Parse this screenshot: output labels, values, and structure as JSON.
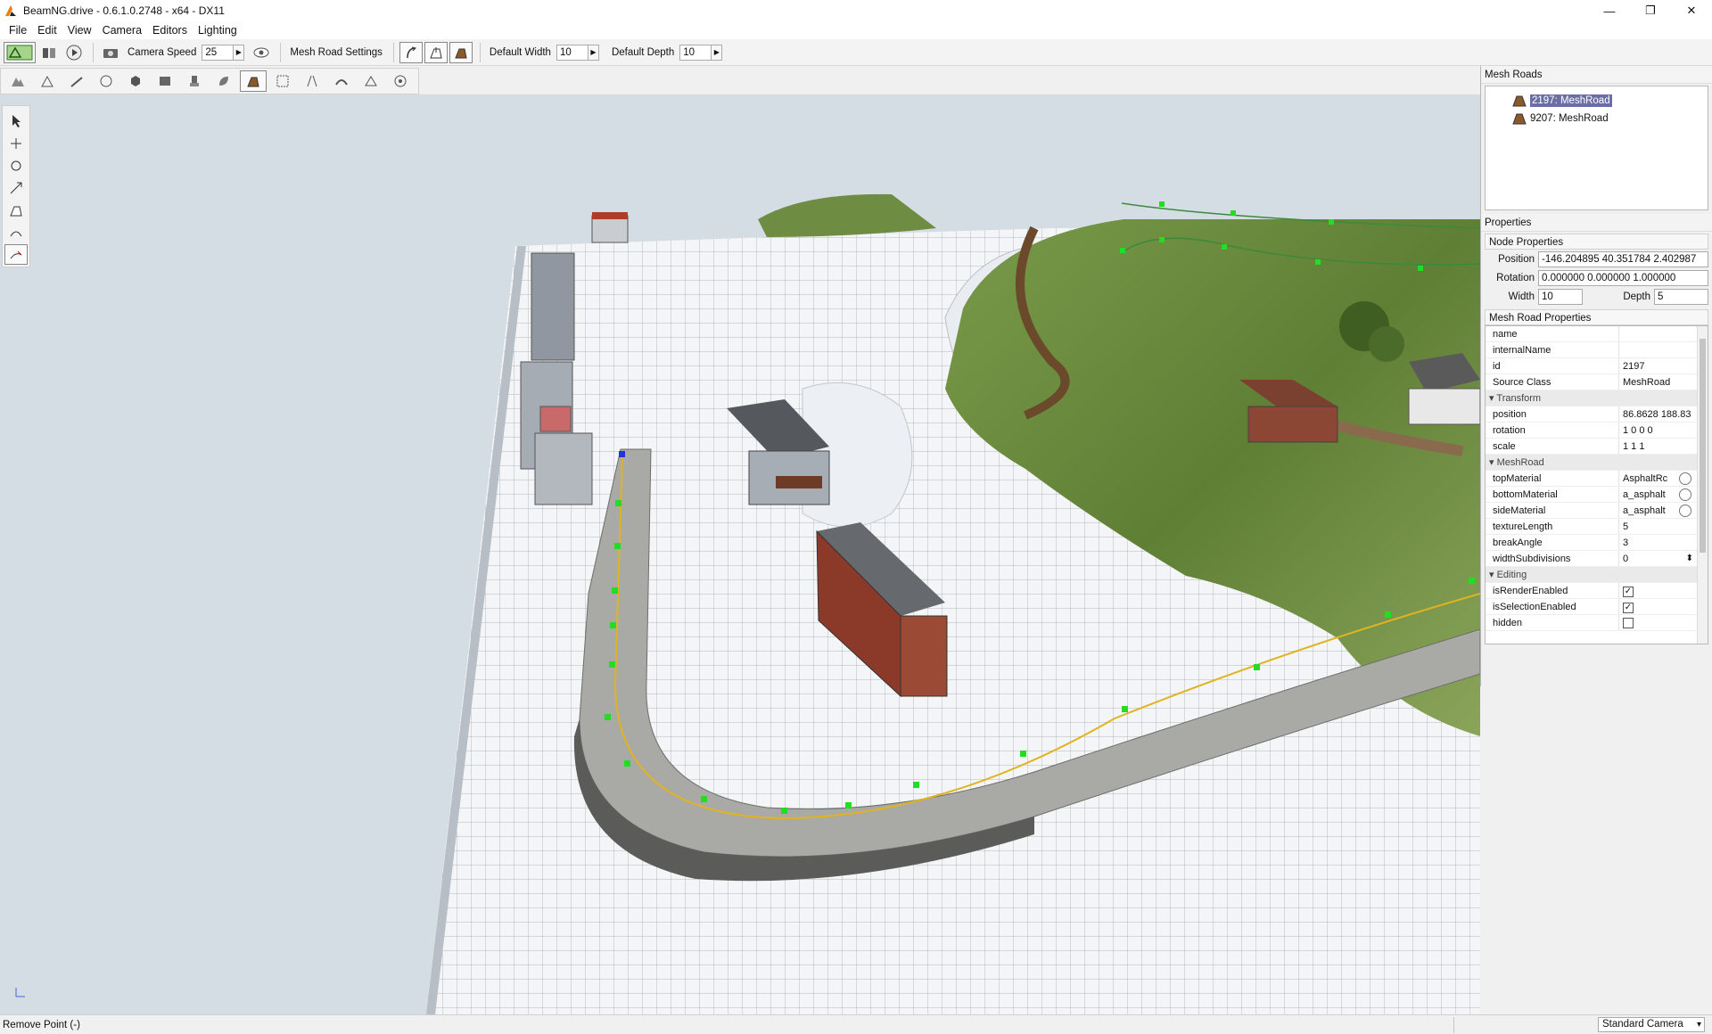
{
  "window": {
    "title": "BeamNG.drive - 0.6.1.0.2748 - x64 - DX11",
    "minimize": "—",
    "maximize": "❐",
    "close": "✕"
  },
  "menu": [
    "File",
    "Edit",
    "View",
    "Camera",
    "Editors",
    "Lighting"
  ],
  "toolbar": {
    "camera_speed_label": "Camera Speed",
    "camera_speed_value": "25",
    "mesh_road_settings_label": "Mesh Road Settings",
    "default_width_label": "Default Width",
    "default_width_value": "10",
    "default_depth_label": "Default Depth",
    "default_depth_value": "10"
  },
  "mesh_roads_panel": {
    "title": "Mesh Roads",
    "items": [
      {
        "label": "2197: MeshRoad",
        "selected": true
      },
      {
        "label": "9207: MeshRoad",
        "selected": false
      }
    ]
  },
  "properties_panel": {
    "title": "Properties",
    "node_properties": {
      "header": "Node Properties",
      "position_label": "Position",
      "position_value": "-146.204895 40.351784 2.402987",
      "rotation_label": "Rotation",
      "rotation_value": "0.000000 0.000000 1.000000",
      "width_label": "Width",
      "width_value": "10",
      "depth_label": "Depth",
      "depth_value": "5"
    },
    "mesh_road_properties": {
      "header": "Mesh Road Properties",
      "rows": [
        {
          "key": "name",
          "value": ""
        },
        {
          "key": "internalName",
          "value": ""
        },
        {
          "key": "id",
          "value": "2197"
        },
        {
          "key": "Source Class",
          "value": "MeshRoad"
        }
      ],
      "transform_header": "Transform",
      "transform_rows": [
        {
          "key": "position",
          "value": "86.8628 188.83"
        },
        {
          "key": "rotation",
          "value": "1 0 0 0"
        },
        {
          "key": "scale",
          "value": "1 1 1"
        }
      ],
      "meshroad_header": "MeshRoad",
      "meshroad_rows": [
        {
          "key": "topMaterial",
          "value": "AsphaltRc"
        },
        {
          "key": "bottomMaterial",
          "value": "a_asphalt"
        },
        {
          "key": "sideMaterial",
          "value": "a_asphalt"
        },
        {
          "key": "textureLength",
          "value": "5"
        },
        {
          "key": "breakAngle",
          "value": "3"
        },
        {
          "key": "widthSubdivisions",
          "value": "0"
        }
      ],
      "editing_header": "Editing",
      "editing_rows": [
        {
          "key": "isRenderEnabled",
          "checked": true
        },
        {
          "key": "isSelectionEnabled",
          "checked": true
        },
        {
          "key": "hidden",
          "checked": false
        }
      ]
    }
  },
  "status": {
    "message": "Remove Point (-)",
    "camera_mode": "Standard Camera"
  }
}
